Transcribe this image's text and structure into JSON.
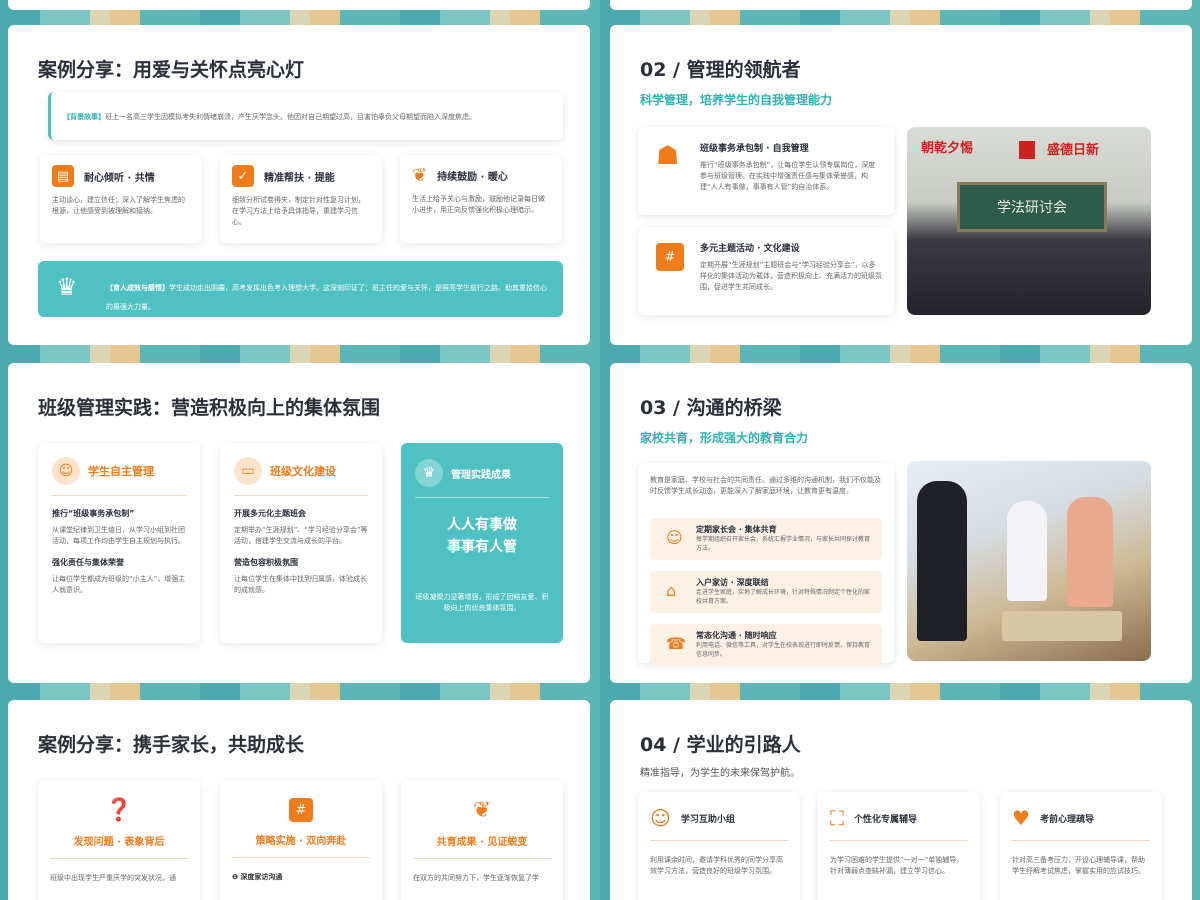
{
  "slide1": {
    "title": "案例分享：用爱与关怀点亮心灯",
    "background_label": "【背景故事】",
    "background_text": "班上一名高三学生因模拟考失利情绪崩溃，产生厌学念头。他因对自己期望过高，且害怕辜负父母期望而陷入深度焦虑。",
    "cards": [
      {
        "icon": "chat-icon",
        "title": "耐心倾听 · 共情",
        "text": "主动谈心，建立信任；深入了解学生焦虑的根源，让他感受到被理解和接纳。"
      },
      {
        "icon": "calendar-check-icon",
        "title": "精准帮扶 · 提能",
        "text": "细致分析试卷得失，制定针对性复习计划，在学习方法上给予具体指导，重建学习信心。"
      },
      {
        "icon": "sprout-icon",
        "title": "持续鼓励 · 暖心",
        "text": "生活上给予关心与激励，鼓励他记录每日微小进步，用正向反馈强化积极心理暗示。"
      }
    ],
    "result_label": "【育人成效与感悟】",
    "result_text": "学生成功走出阴霾，高考发挥出色考入理想大学。这深刻印证了：班主任的爱与关怀，是照亮学生前行之路、助其重拾信心的最强大力量。"
  },
  "slide2": {
    "title": "02 / 管理的领航者",
    "subtitle": "科学管理，培养学生的自我管理能力",
    "items": [
      {
        "icon": "person-icon",
        "title": "班级事务承包制 · 自我管理",
        "text": "推行“班级事务承包制”，让每位学生认领专属岗位，深度参与班级管理。在实践中增强责任感与集体荣誉感，构建“人人有事做，事事有人管”的自治体系。"
      },
      {
        "icon": "hash-icon",
        "title": "多元主题活动 · 文化建设",
        "text": "定期开展“生涯规划”主题班会与“学习经验分享会”，以多样化的集体活动为载体，营造积极向上、充满活力的班级氛围，促进学生共同成长。"
      }
    ],
    "photo_banner_left": "朝乾夕惕",
    "photo_banner_right": "盛德日新",
    "photo_board": "学法研讨会"
  },
  "slide3": {
    "title": "班级管理实践：营造积极向上的集体氛围",
    "col1": {
      "title": "学生自主管理",
      "h1": "推行“班级事务承包制”",
      "t1": "从课堂纪律到卫生值日，从学习小组到社团活动，每项工作均由学生自主规划与执行。",
      "h2": "强化责任与集体荣誉",
      "t2": "让每位学生都成为班级的“小主人”，增强主人翁意识。"
    },
    "col2": {
      "title": "班级文化建设",
      "h1": "开展多元化主题班会",
      "t1": "定期举办“生涯规划”、“学习经验分享会”等活动，搭建学生交流与成长的平台。",
      "h2": "营造包容积极氛围",
      "t2": "让每位学生在集体中找到归属感，体验成长的成就感。"
    },
    "col3": {
      "title": "管理实践成果",
      "big1": "人人有事做",
      "big2": "事事有人管",
      "text": "班级凝聚力显著增强，形成了团结友爱、积极向上的优良集体氛围。"
    }
  },
  "slide4": {
    "title": "03 / 沟通的桥梁",
    "subtitle": "家校共育，形成强大的教育合力",
    "intro": "教育是家庭、学校与社会的共同责任。通过多维的沟通机制，我们不仅能及时反馈学生成长动态，更能深入了解家庭环境，让教育更有温度。",
    "items": [
      {
        "icon": "group-icon",
        "title": "定期家长会 · 集体共育",
        "text": "每学期组织召开家长会，系统汇报学业情况，与家长共同探讨教育方法。"
      },
      {
        "icon": "home-icon",
        "title": "入户家访 · 深度联结",
        "text": "走进学生家庭，实地了解成长环境，针对特殊情况制定个性化的家校共育方案。"
      },
      {
        "icon": "phone-icon",
        "title": "常态化沟通 · 随时响应",
        "text": "利用电话、微信等工具，对学生在校表现进行即时反馈，保持教育信息同步。"
      }
    ]
  },
  "slide5": {
    "title": "案例分享：携手家长，共助成长",
    "cards": [
      {
        "icon": "head-question-icon",
        "title": "发现问题 · 表象背后",
        "text": "班级中出现学生严重厌学的突发状况，通"
      },
      {
        "icon": "hash-icon",
        "title": "策略实施 · 双向奔赴",
        "text": "❶ 深度家访沟通"
      },
      {
        "icon": "sprout-icon",
        "title": "共育成果 · 见证蜕变",
        "text": "在双方的共同努力下，学生逐渐恢复了学"
      }
    ]
  },
  "slide6": {
    "title": "04 / 学业的引路人",
    "subtitle": "精准指导，为学生的未来保驾护航。",
    "cards": [
      {
        "icon": "group-icon",
        "title": "学习互助小组",
        "text": "利用课余时间，邀请学科优秀的同学分享高效学习方法，营造良好的班级学习氛围。"
      },
      {
        "icon": "focus-person-icon",
        "title": "个性化专属辅导",
        "text": "为学习困难的学生提供“一对一”单独辅导，针对薄弱点查缺补漏，建立学习信心。"
      },
      {
        "icon": "heart-plus-icon",
        "title": "考前心理疏导",
        "text": "针对高三备考压力，开设心理辅导课，帮助学生纾解考试焦虑，掌握实用的应试技巧。"
      }
    ]
  },
  "colors": {
    "teal": "#4fc1c3",
    "orange": "#f07b1a",
    "title": "#2a2f3a"
  }
}
